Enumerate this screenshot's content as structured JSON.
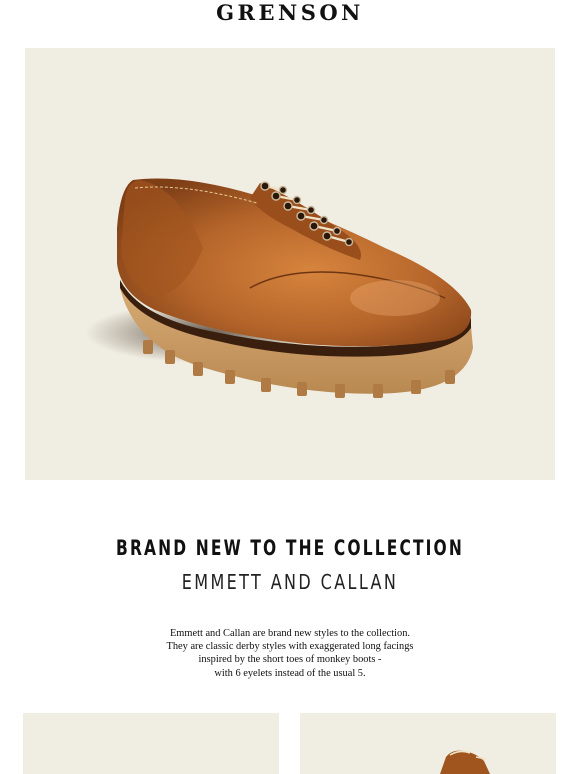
{
  "brand": {
    "logo_text": "GRENSON"
  },
  "hero": {
    "image_alt": "Tan grain leather derby shoe with chunky cleated sole",
    "background_color": "#f0ede2"
  },
  "headline": "BRAND NEW TO THE COLLECTION",
  "subheadline": "EMMETT AND CALLAN",
  "body": [
    "Emmett and Callan are brand new styles to the collection.",
    "They are classic derby styles with exaggerated long facings",
    "inspired by the short toes of monkey boots -",
    "with 6 eyelets instead of the usual 5."
  ],
  "tiles": [
    {
      "name": "product-tile-left",
      "content": "empty"
    },
    {
      "name": "product-tile-right",
      "content": "shoe-partial"
    }
  ],
  "colors": {
    "leather": "#b5652a",
    "sole": "#c99a62",
    "tile_background": "#f0ede2"
  }
}
